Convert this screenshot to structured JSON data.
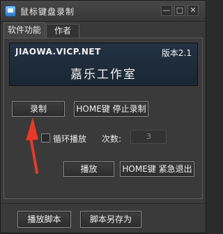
{
  "window": {
    "title": "鼠标键盘录制",
    "controls": {
      "minimize": "—",
      "maximize": "□",
      "close": "✕"
    }
  },
  "tabs": [
    {
      "label": "软件功能",
      "active": true
    },
    {
      "label": "作者",
      "active": false
    }
  ],
  "banner": {
    "url": "JIAOWA.VICP.NET",
    "version": "版本2.1",
    "studio": "嘉乐工作室"
  },
  "buttons": {
    "record": "录制",
    "stop_record": "HOME键 停止录制",
    "play": "播放",
    "emergency_exit": "HOME键 紧急退出",
    "play_script": "播放脚本",
    "save_script_as": "脚本另存为"
  },
  "loop": {
    "label": "循环播放",
    "checked": false
  },
  "count": {
    "label": "次数:",
    "value": "3"
  },
  "annotation": {
    "arrow_color": "#e53a2a"
  }
}
